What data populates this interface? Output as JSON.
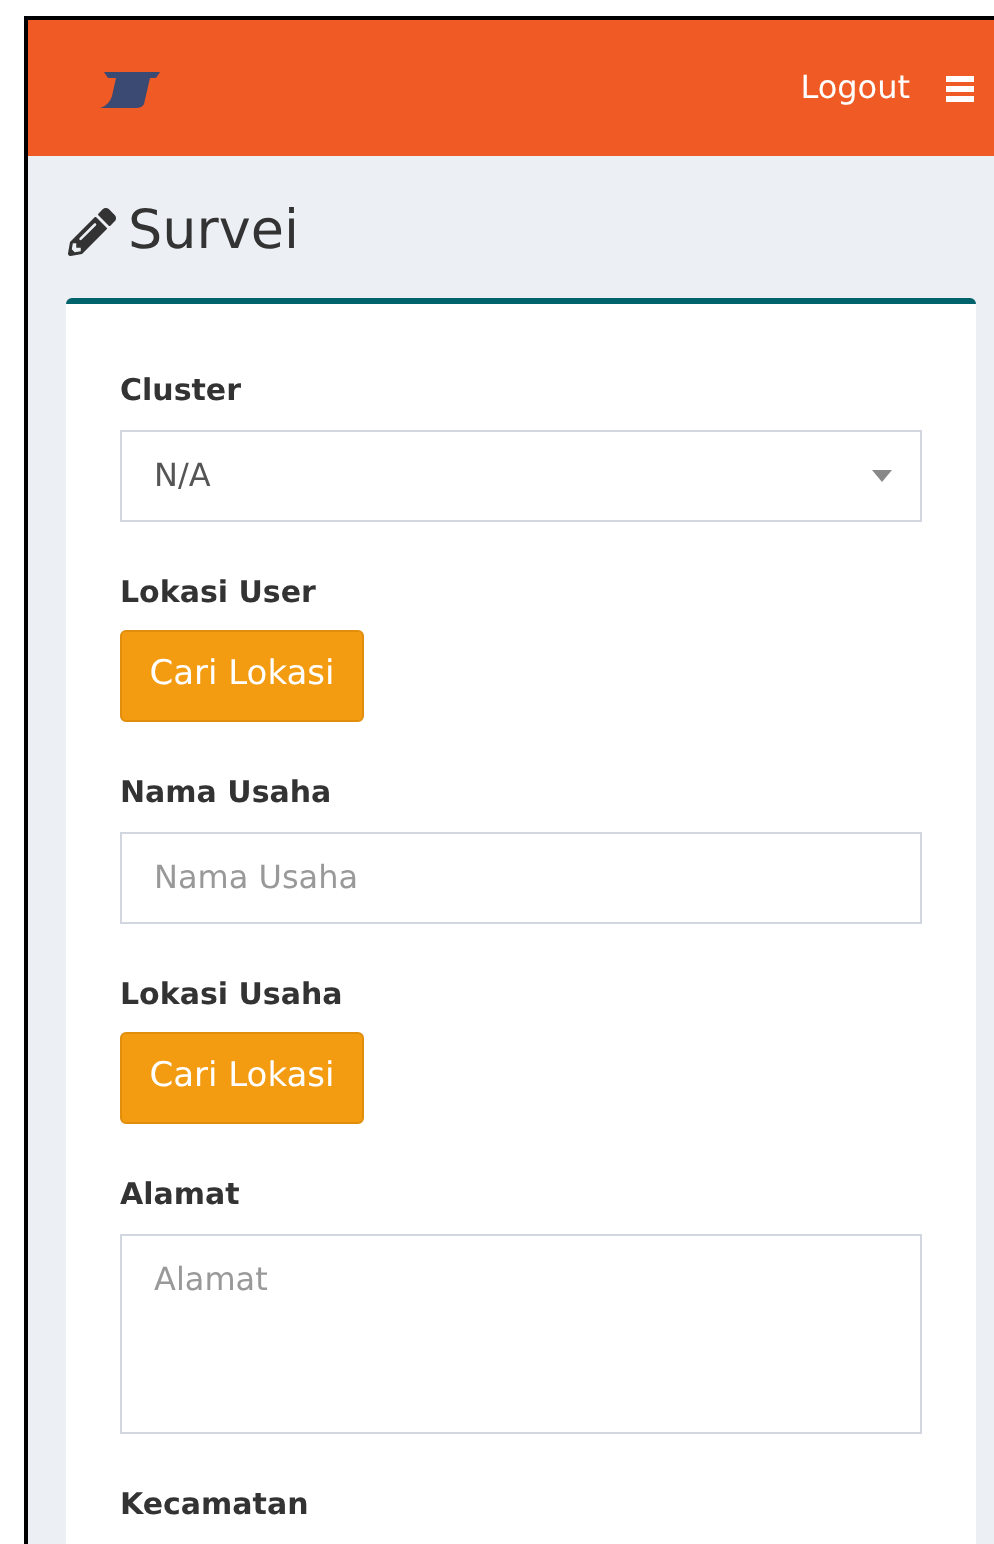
{
  "header": {
    "logout": "Logout"
  },
  "page_title": "Survei",
  "fields": [
    {
      "kind": "select",
      "label": "Cluster",
      "value": "N/A"
    },
    {
      "kind": "button",
      "label": "Lokasi User",
      "button": "Cari Lokasi"
    },
    {
      "kind": "input",
      "label": "Nama Usaha",
      "placeholder": "Nama Usaha"
    },
    {
      "kind": "button",
      "label": "Lokasi Usaha",
      "button": "Cari Lokasi"
    },
    {
      "kind": "textarea",
      "label": "Alamat",
      "placeholder": "Alamat"
    },
    {
      "kind": "label",
      "label": "Kecamatan"
    }
  ]
}
